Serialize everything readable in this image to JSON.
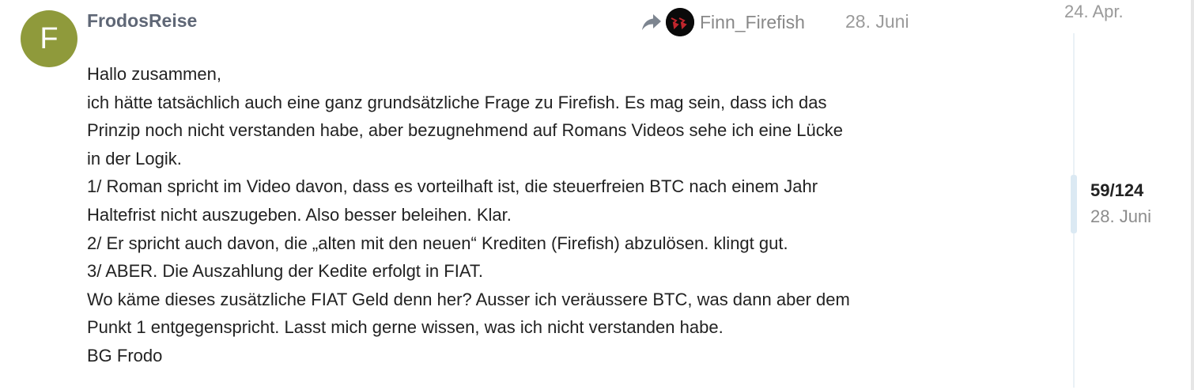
{
  "post": {
    "author": {
      "username": "FrodosReise",
      "avatar_letter": "F",
      "avatar_color": "#8f9a3b"
    },
    "reply_to": {
      "icon": "reply-arrow-icon",
      "username": "Finn_Firefish",
      "avatar_color": "#0a0a0a"
    },
    "date": "28. Juni",
    "body": [
      "Hallo zusammen,",
      "ich hätte tatsächlich auch eine ganz grundsätzliche Frage zu Firefish. Es mag sein, dass ich das",
      "Prinzip noch nicht verstanden habe, aber bezugnehmend auf Romans Videos sehe ich eine Lücke",
      "in der Logik.",
      "1/ Roman spricht im Video davon, dass es vorteilhaft ist, die steuerfreien BTC nach einem Jahr",
      "Haltefrist nicht auszugeben. Also besser beleihen. Klar.",
      "2/ Er spricht auch davon, die „alten mit den neuen“ Krediten (Firefish) abzulösen. klingt gut.",
      "3/ ABER. Die Auszahlung der Kedite erfolgt in FIAT.",
      "Wo käme dieses zusätzliche FIAT Geld denn her? Ausser ich veräussere BTC, was dann aber dem",
      "Punkt 1 entgegenspricht. Lasst mich gerne wissen, was ich nicht verstanden habe.",
      "BG Frodo"
    ]
  },
  "timeline": {
    "start_date": "24. Apr.",
    "position": "59/124",
    "current_date": "28. Juni",
    "progress_fraction": 0.476
  }
}
